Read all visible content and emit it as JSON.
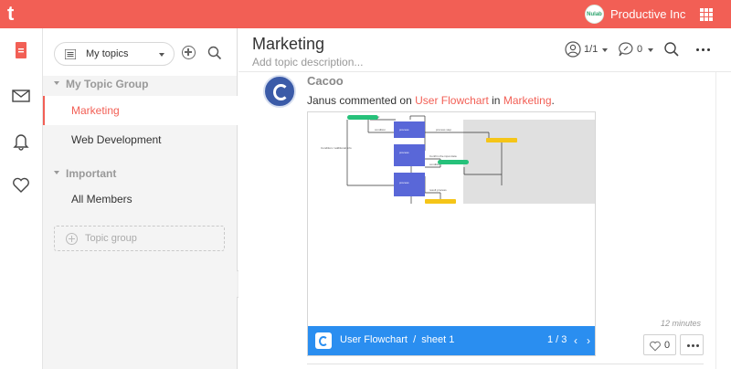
{
  "header": {
    "logo_letter": "t",
    "org_name": "Productive Inc",
    "org_avatar_text": "Nulab"
  },
  "topics_panel": {
    "selector_label": "My topics",
    "groups": [
      {
        "name": "My Topic Group",
        "items": [
          "Marketing",
          "Web Development"
        ]
      },
      {
        "name": "Important",
        "items": [
          "All Members"
        ]
      }
    ],
    "active_item": "Marketing",
    "new_group_label": "Topic group"
  },
  "main": {
    "title": "Marketing",
    "description_placeholder": "Add topic description...",
    "members_count": "1/1",
    "notes_count": "0"
  },
  "post": {
    "author": "Cacoo",
    "actor": "Janus",
    "verb": "commented on",
    "target": "User Flowchart",
    "preposition": "in",
    "topic": "Marketing",
    "period": ".",
    "preview": {
      "file_name": "User Flowchart",
      "separator": "/",
      "sheet": "sheet 1",
      "page": "1 / 3"
    },
    "time": "12 minutes",
    "likes": "0"
  },
  "colors": {
    "brand": "#f25f55",
    "cacoo_blue": "#2a8ef0",
    "flow_box": "#5967d8",
    "flow_green": "#26c17a",
    "flow_yellow": "#f5c518"
  }
}
